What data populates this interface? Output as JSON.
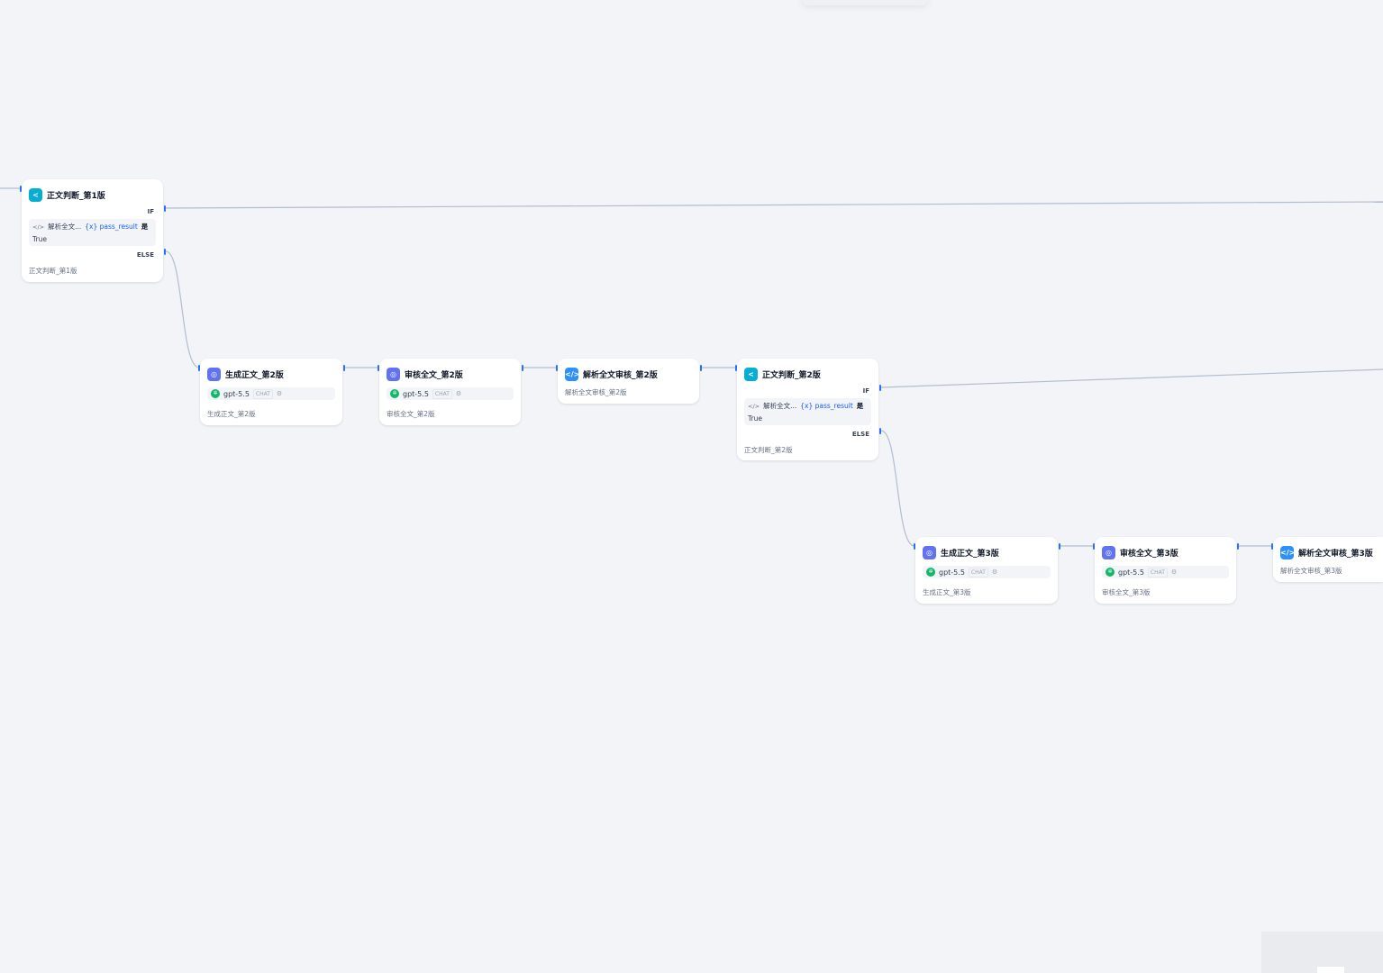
{
  "icons": {
    "if": "branch-icon",
    "llm": "llm-icon",
    "code": "code-icon",
    "model": "openai-icon",
    "config": "settings-icon"
  },
  "colors": {
    "canvas": "#f2f4f7",
    "if_icon": "#06aed4",
    "llm_icon": "#6172f3",
    "code_icon": "#2e90fa",
    "edge": "#b2bdd0",
    "handle": "#2970ff"
  },
  "if_labels": {
    "if": "IF",
    "else": "ELSE"
  },
  "nodes": {
    "if1": {
      "title": "正文判断_第1版",
      "desc": "正文判断_第1版",
      "condition": {
        "code_glyph": "</>",
        "node": "解析全文...",
        "var": "{x} pass_result",
        "op": "是",
        "value": "True"
      }
    },
    "gen2": {
      "title": "生成正文_第2版",
      "model": "gpt-5.5",
      "tag": "CHAT",
      "cfg": "⚙",
      "desc": "生成正文_第2版"
    },
    "review2": {
      "title": "审核全文_第2版",
      "model": "gpt-5.5",
      "tag": "CHAT",
      "cfg": "⚙",
      "desc": "审核全文_第2版"
    },
    "parse2": {
      "title": "解析全文审核_第2版",
      "desc": "解析全文审核_第2版"
    },
    "if2": {
      "title": "正文判断_第2版",
      "desc": "正文判断_第2版",
      "condition": {
        "code_glyph": "</>",
        "node": "解析全文...",
        "var": "{x} pass_result",
        "op": "是",
        "value": "True"
      }
    },
    "gen3": {
      "title": "生成正文_第3版",
      "model": "gpt-5.5",
      "tag": "CHAT",
      "cfg": "⚙",
      "desc": "生成正文_第3版"
    },
    "review3": {
      "title": "审核全文_第3版",
      "model": "gpt-5.5",
      "tag": "CHAT",
      "cfg": "⚙",
      "desc": "审核全文_第3版"
    },
    "parse3": {
      "title": "解析全文审核_第3版",
      "desc": "解析全文审核_第3版"
    }
  }
}
